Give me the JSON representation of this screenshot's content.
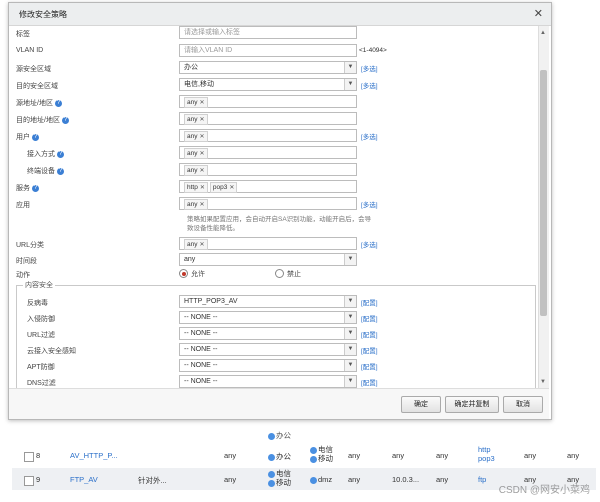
{
  "dialog": {
    "title": "修改安全策略",
    "close_icon": "close-icon",
    "fields": {
      "tag": {
        "label": "标签",
        "placeholder": "请选择或输入标签"
      },
      "vlan": {
        "label": "VLAN ID",
        "placeholder": "请输入VLAN ID",
        "hint": "<1-4094>"
      },
      "src_zone": {
        "label": "源安全区域",
        "value": "办公",
        "more": "[多选]"
      },
      "dst_zone": {
        "label": "目的安全区域",
        "value": "电信,移动",
        "more": "[多选]"
      },
      "src_addr": {
        "label": "源地址/地区",
        "tags": [
          "any"
        ]
      },
      "dst_addr": {
        "label": "目的地址/地区",
        "tags": [
          "any"
        ]
      },
      "user": {
        "label": "用户",
        "tags": [
          "any"
        ],
        "more": "[多选]"
      },
      "access": {
        "label": "接入方式",
        "tags": [
          "any"
        ]
      },
      "terminal": {
        "label": "终端设备",
        "tags": [
          "any"
        ]
      },
      "service": {
        "label": "服务",
        "tags": [
          "http",
          "pop3"
        ]
      },
      "application": {
        "label": "应用",
        "tags": [
          "any"
        ],
        "more": "[多选]",
        "note": "策略如果配置应用，会自动开启SA识别功能，动能开启后，会导致设备性能降低。"
      },
      "url_cat": {
        "label": "URL分类",
        "tags": [
          "any"
        ],
        "more": "[多选]"
      },
      "schedule": {
        "label": "时间段",
        "value": "any"
      },
      "action": {
        "label": "动作",
        "allow": "允许",
        "deny": "禁止"
      }
    },
    "content_security": {
      "legend": "内容安全",
      "rows": [
        {
          "label": "反病毒",
          "value": "HTTP_POP3_AV",
          "config": "[配置]"
        },
        {
          "label": "入侵防御",
          "value": "-- NONE --",
          "config": "[配置]"
        },
        {
          "label": "URL过滤",
          "value": "-- NONE --",
          "config": "[配置]"
        },
        {
          "label": "云接入安全感知",
          "value": "-- NONE --",
          "config": "[配置]"
        },
        {
          "label": "APT防御",
          "value": "-- NONE --",
          "config": "[配置]"
        },
        {
          "label": "DNS过滤",
          "value": "-- NONE --",
          "config": "[配置]"
        }
      ]
    },
    "buttons": {
      "ok": "确定",
      "ok_copy": "确定并复制",
      "cancel": "取消"
    }
  },
  "table": {
    "top_partial": "办公",
    "rows": [
      {
        "no": "8",
        "name": "AV_HTTP_P...",
        "desc": "",
        "src_zone": "any",
        "zone_a": "办公",
        "dst_zones": [
          "电信",
          "移动"
        ],
        "src": "any",
        "dst": "any",
        "user": "any",
        "service": [
          "http",
          "pop3"
        ],
        "c1": "any",
        "c2": "any"
      },
      {
        "no": "9",
        "name": "FTP_AV",
        "desc": "针对外...",
        "src_zone": "any",
        "zone_a_list": [
          "电信",
          "移动"
        ],
        "dst_zone": "dmz",
        "src": "any",
        "dst": "10.0.3...",
        "user": "any",
        "service_partial": "ftp",
        "c1": "any",
        "c2": "any"
      }
    ]
  },
  "watermark": "CSDN @网安小菜鸡"
}
